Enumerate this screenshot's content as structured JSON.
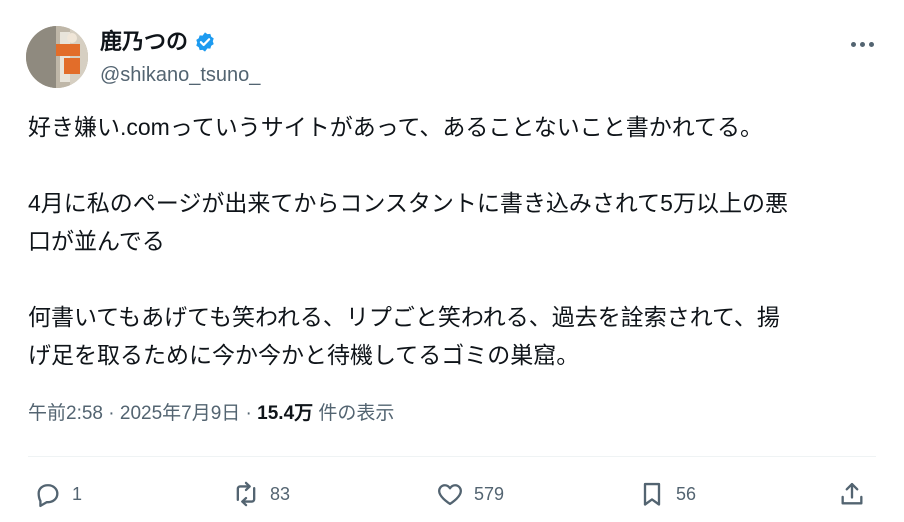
{
  "author": {
    "display_name": "鹿乃つの",
    "handle": "@shikano_tsuno_",
    "verified": true,
    "verified_icon": "verified-badge-icon",
    "verified_color": "#1d9bf0"
  },
  "tweet": {
    "paragraphs": [
      "好き嫌い.comっていうサイトがあって、あることないこと書かれてる。",
      "4月に私のページが出来てからコンスタントに書き込みされて5万以上の悪",
      "口が並んでる",
      "何書いてもあげても笑われる、リプごと笑われる、過去を詮索されて、揚",
      "げ足を取るために今か今かと待機してるゴミの巣窟。"
    ]
  },
  "meta": {
    "time": "午前2:58",
    "separator1": " · ",
    "date": "2025年7月9日",
    "separator2": " · ",
    "views_count": "15.4万",
    "views_label": " 件の表示"
  },
  "actions": {
    "reply_count": "1",
    "repost_count": "83",
    "like_count": "579",
    "bookmark_count": "56"
  },
  "colors": {
    "text": "#0f1419",
    "secondary": "#536471",
    "divider": "#eff3f4"
  }
}
